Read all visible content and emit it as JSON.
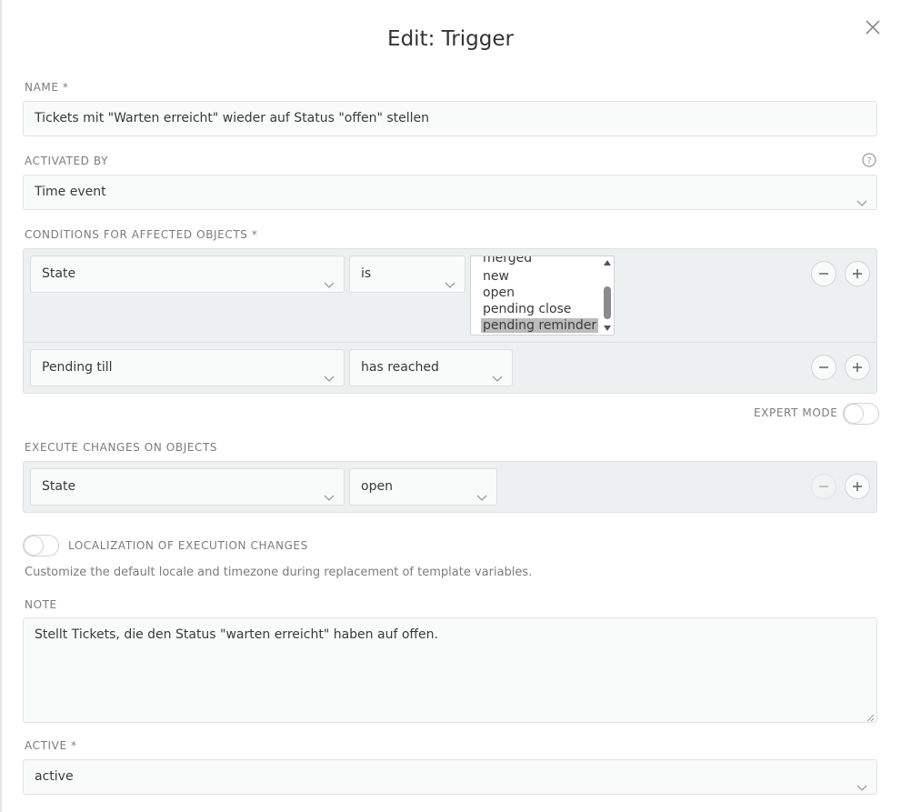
{
  "dialog": {
    "title": "Edit: Trigger"
  },
  "name": {
    "label": "NAME *",
    "value": "Tickets mit \"Warten erreicht\" wieder auf Status \"offen\" stellen"
  },
  "activated_by": {
    "label": "ACTIVATED BY",
    "value": "Time event"
  },
  "conditions": {
    "label": "CONDITIONS FOR AFFECTED OBJECTS *",
    "rows": [
      {
        "attribute": "State",
        "operator": "is",
        "options": [
          "merged",
          "new",
          "open",
          "pending close",
          "pending reminder"
        ],
        "selected": "pending reminder"
      },
      {
        "attribute": "Pending till",
        "operator": "has reached"
      }
    ]
  },
  "expert_mode": {
    "label": "EXPERT MODE"
  },
  "execute": {
    "label": "EXECUTE CHANGES ON OBJECTS",
    "rows": [
      {
        "attribute": "State",
        "value": "open"
      }
    ]
  },
  "localization": {
    "label": "LOCALIZATION OF EXECUTION CHANGES",
    "description": "Customize the default locale and timezone during replacement of template variables."
  },
  "note": {
    "label": "NOTE",
    "value": "Stellt Tickets, die den Status \"warten erreicht\" haben auf offen."
  },
  "active": {
    "label": "ACTIVE *",
    "value": "active"
  },
  "icons": {
    "close": "close-icon",
    "chevron": "chevron-down-icon",
    "help": "help-icon",
    "remove": "minus-icon",
    "add": "plus-icon"
  }
}
